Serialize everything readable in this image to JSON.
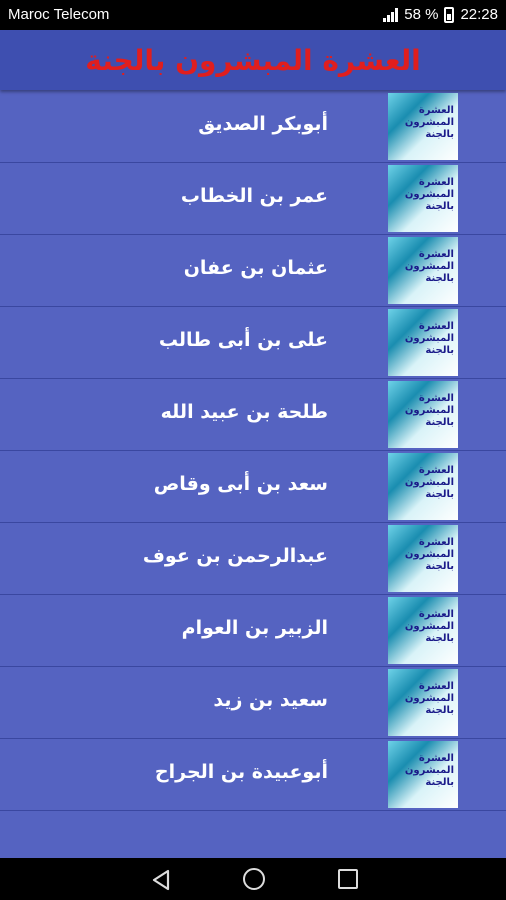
{
  "status": {
    "carrier": "Maroc Telecom",
    "battery": "58 %",
    "time": "22:28"
  },
  "header": {
    "title": "العشرة المبشرون بالجنة"
  },
  "thumb_text": "العشرة المبشرون بالجنة",
  "items": [
    {
      "label": "أبوبكر الصديق"
    },
    {
      "label": "عمر بن الخطاب"
    },
    {
      "label": "عثمان بن عفان"
    },
    {
      "label": "على بن أبى طالب"
    },
    {
      "label": "طلحة بن عبيد الله"
    },
    {
      "label": "سعد بن أبى وقاص"
    },
    {
      "label": "عبدالرحمن بن عوف"
    },
    {
      "label": "الزبير بن العوام"
    },
    {
      "label": "سعيد بن زيد"
    },
    {
      "label": "أبوعبيدة بن الجراح"
    }
  ],
  "colors": {
    "background": "#5563c1",
    "header": "#3e4fb0",
    "title": "#e01e1e"
  },
  "icons": {
    "nav": [
      "back-icon",
      "home-icon",
      "recents-icon"
    ]
  }
}
